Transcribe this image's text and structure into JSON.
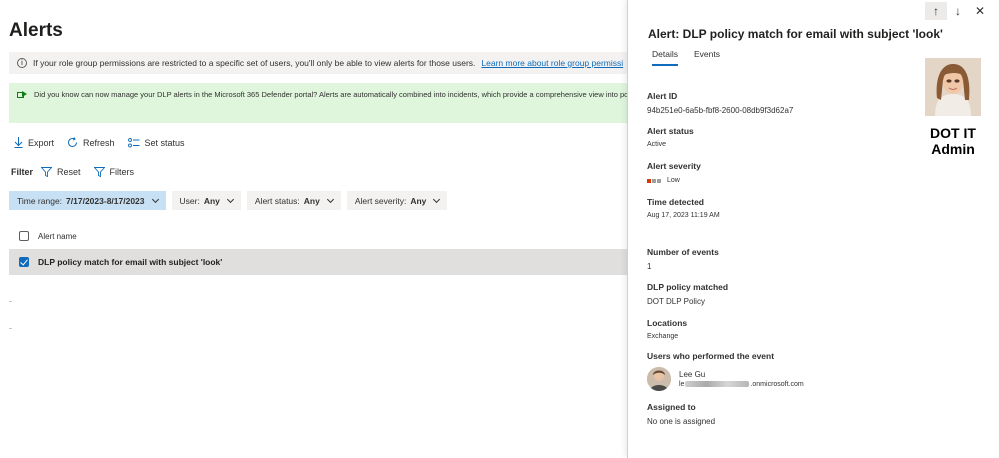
{
  "page": {
    "title": "Alerts",
    "info_text": "If your role group permissions are restricted to a specific set of users, you'll only be able to view alerts for those users.",
    "info_link": "Learn more about role group permissi",
    "defender_text": "Did you know can now manage your DLP alerts in the Microsoft 365 Defender portal? Alerts are automatically combined into incidents, which provide a comprehensive view into pote"
  },
  "toolbar": {
    "export_label": "Export",
    "refresh_label": "Refresh",
    "set_status_label": "Set status"
  },
  "filters": {
    "label": "Filter",
    "reset_label": "Reset",
    "filters_label": "Filters",
    "chips": [
      {
        "name": "Time range:",
        "value": "7/17/2023-8/17/2023"
      },
      {
        "name": "User:",
        "value": "Any"
      },
      {
        "name": "Alert status:",
        "value": "Any"
      },
      {
        "name": "Alert severity:",
        "value": "Any"
      }
    ]
  },
  "table": {
    "header": "Alert name",
    "rows": [
      {
        "name": "DLP policy match for email with subject 'look'"
      }
    ]
  },
  "panel": {
    "title": "Alert: DLP policy match for email with subject 'look'",
    "tabs": [
      "Details",
      "Events"
    ],
    "admin_caption_line1": "DOT IT",
    "admin_caption_line2": "Admin",
    "alert_id_label": "Alert ID",
    "alert_id": "94b251e0-6a5b-fbf8-2600-08db9f3d62a7",
    "status_label": "Alert status",
    "status": "Active",
    "severity_label": "Alert severity",
    "severity": "Low",
    "severity_colors": [
      "#d83b01",
      "#a19f9d",
      "#a19f9d"
    ],
    "time_label": "Time detected",
    "time": "Aug 17, 2023 11:19 AM",
    "events_label": "Number of events",
    "events": "1",
    "policy_label": "DLP policy matched",
    "policy": "DOT DLP Policy",
    "locations_label": "Locations",
    "locations": "Exchange",
    "users_label": "Users who performed the event",
    "user_name": "Lee Gu",
    "user_mail_prefix": "le",
    "user_mail_suffix": ".onmicrosoft.com",
    "assigned_label": "Assigned to",
    "assigned": "No one is assigned"
  }
}
